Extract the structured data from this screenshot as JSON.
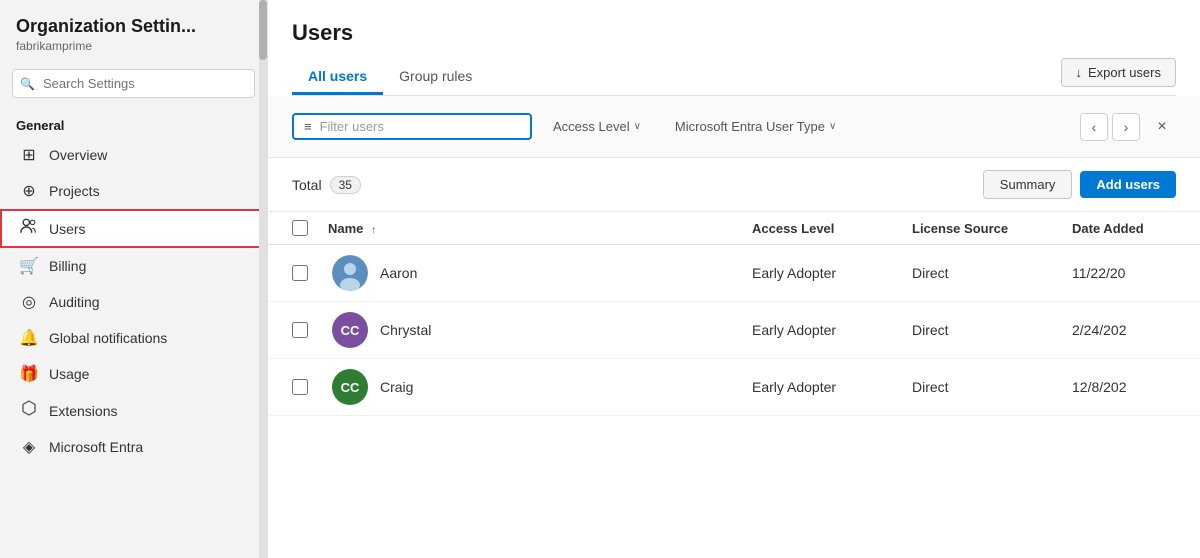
{
  "sidebar": {
    "title": "Organization Settin...",
    "subtitle": "fabrikamprime",
    "search_placeholder": "Search Settings",
    "section_label": "General",
    "nav_items": [
      {
        "id": "overview",
        "label": "Overview",
        "icon": "⊞"
      },
      {
        "id": "projects",
        "label": "Projects",
        "icon": "⊕"
      },
      {
        "id": "users",
        "label": "Users",
        "icon": "👥",
        "active": true
      },
      {
        "id": "billing",
        "label": "Billing",
        "icon": "🛒"
      },
      {
        "id": "auditing",
        "label": "Auditing",
        "icon": "◎"
      },
      {
        "id": "global-notifications",
        "label": "Global notifications",
        "icon": "🔔"
      },
      {
        "id": "usage",
        "label": "Usage",
        "icon": "🎁"
      },
      {
        "id": "extensions",
        "label": "Extensions",
        "icon": "⬡"
      },
      {
        "id": "microsoft-entra",
        "label": "Microsoft Entra",
        "icon": "◈"
      }
    ]
  },
  "main": {
    "title": "Users",
    "tabs": [
      {
        "id": "all-users",
        "label": "All users",
        "active": true
      },
      {
        "id": "group-rules",
        "label": "Group rules",
        "active": false
      }
    ],
    "export_btn_label": "Export users",
    "filter": {
      "placeholder": "Filter users",
      "access_level_label": "Access Level",
      "user_type_label": "Microsoft Entra User Type"
    },
    "toolbar": {
      "total_label": "Total",
      "total_count": "35",
      "summary_label": "Summary",
      "add_users_label": "Add users"
    },
    "table": {
      "columns": [
        "Name",
        "Access Level",
        "License Source",
        "Date Added"
      ],
      "rows": [
        {
          "name": "Aaron",
          "avatar_text": null,
          "avatar_type": "img",
          "avatar_color": "#5a8fc0",
          "access_level": "Early Adopter",
          "license_source": "Direct",
          "date_added": "11/22/20"
        },
        {
          "name": "Chrystal",
          "avatar_text": "CC",
          "avatar_type": "initials",
          "avatar_color": "#7b4fa0",
          "access_level": "Early Adopter",
          "license_source": "Direct",
          "date_added": "2/24/202"
        },
        {
          "name": "Craig",
          "avatar_text": "CC",
          "avatar_type": "initials",
          "avatar_color": "#2e7d32",
          "access_level": "Early Adopter",
          "license_source": "Direct",
          "date_added": "12/8/202"
        }
      ]
    }
  },
  "icons": {
    "search": "🔍",
    "filter": "≡",
    "chevron_down": "∨",
    "chevron_left": "‹",
    "chevron_right": "›",
    "close": "×",
    "export_down": "↓",
    "sort_up": "↑"
  }
}
